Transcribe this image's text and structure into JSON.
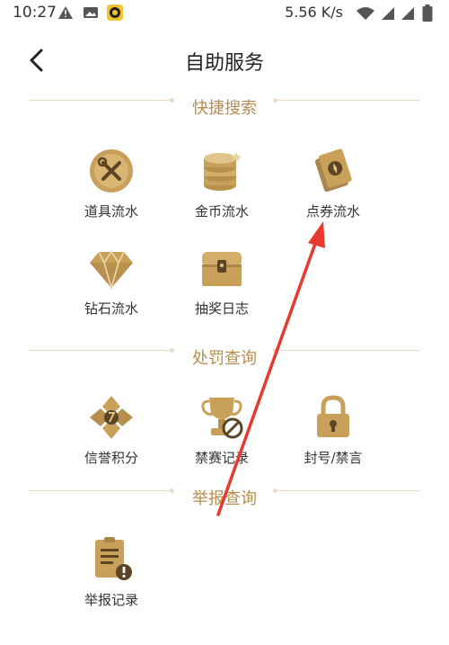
{
  "status_bar": {
    "time": "10:27",
    "speed": "5.56 K/s",
    "icons": [
      "warning-icon",
      "image-icon",
      "app-notification-icon",
      "wifi-icon",
      "signal-icon",
      "signal-icon",
      "battery-icon"
    ]
  },
  "header": {
    "title": "自助服务",
    "back_icon": "chevron-left-icon"
  },
  "sections": {
    "quick_search": {
      "title": "快捷搜索",
      "items": [
        {
          "label": "道具流水",
          "icon": "tools-coin-icon"
        },
        {
          "label": "金币流水",
          "icon": "coin-stack-icon"
        },
        {
          "label": "点券流水",
          "icon": "coupon-icon"
        },
        {
          "label": "钻石流水",
          "icon": "diamond-icon"
        },
        {
          "label": "抽奖日志",
          "icon": "treasure-chest-icon"
        }
      ]
    },
    "penalty": {
      "title": "处罚查询",
      "items": [
        {
          "label": "信誉积分",
          "icon": "credit-badge-icon"
        },
        {
          "label": "禁赛记录",
          "icon": "banned-trophy-icon"
        },
        {
          "label": "封号/禁言",
          "icon": "padlock-icon"
        }
      ]
    },
    "report": {
      "title": "举报查询",
      "items": [
        {
          "label": "举报记录",
          "icon": "report-document-icon"
        }
      ]
    }
  },
  "colors": {
    "accent_gold": "#c9a05a",
    "section_text": "#b58e4f",
    "annotation_red": "#e53a2f"
  }
}
